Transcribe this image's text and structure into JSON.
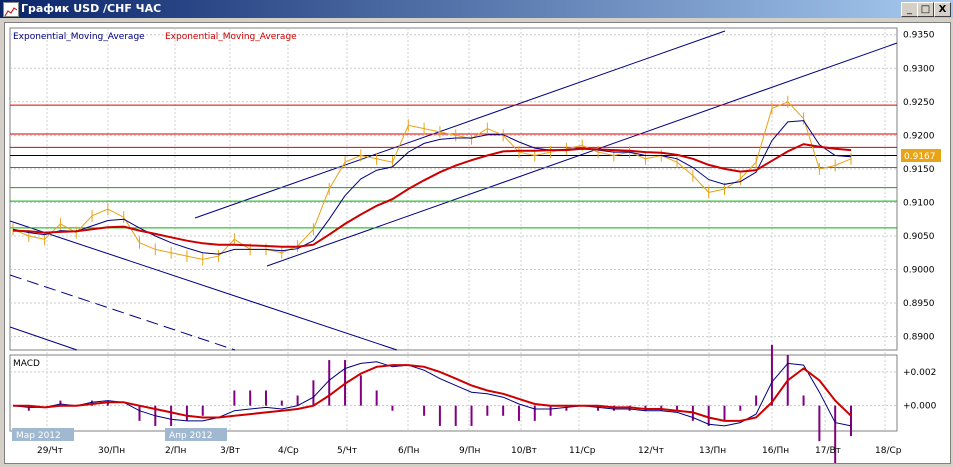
{
  "window": {
    "title": "График USD /CHF ЧАС",
    "minimize_label": "_",
    "maximize_label": "□",
    "close_label": "X"
  },
  "indicators": {
    "ema1": "Exponential_Moving_Average",
    "ema2": "Exponential_Moving_Average"
  },
  "macd_label": "MACD",
  "current_price": "0.9167",
  "month_labels": [
    "Мар 2012",
    "Апр 2012"
  ],
  "colors": {
    "price_line": "#e8a317",
    "ema_slow": "#cc0000",
    "ema_fast": "#000080",
    "channel": "#000080",
    "resistance": "#e00000",
    "support": "#00b000",
    "macd_hist": "#800080",
    "badge": "#e8a317"
  },
  "chart_data": {
    "type": "line",
    "price_axis": {
      "ylim": [
        0.888,
        0.936
      ],
      "tick_labels": [
        "0.9350",
        "0.9300",
        "0.9250",
        "0.9200",
        "0.9150",
        "0.9100",
        "0.9050",
        "0.9000",
        "0.8950",
        "0.8900"
      ]
    },
    "macd_axis": {
      "tick_labels": [
        "+0.002",
        "+0.000"
      ]
    },
    "x_labels": [
      "29/Чт",
      "30/Пн",
      "2/Пн",
      "3/Вт",
      "4/Ср",
      "5/Чт",
      "6/Пн",
      "9/Пн",
      "10/Вт",
      "11/Ср",
      "12/Чт",
      "13/Пн",
      "16/Пн",
      "17/Вт",
      "18/Ср"
    ],
    "horizontal_levels": {
      "red": [
        0.9245,
        0.9202,
        0.9182
      ],
      "dark": [
        0.917
      ],
      "green": [
        0.9152,
        0.9122,
        0.9102,
        0.9062
      ]
    },
    "series": [
      {
        "values": [
          0.906,
          0.905,
          0.9045,
          0.9068,
          0.9055,
          0.908,
          0.909,
          0.9078,
          0.904,
          0.903,
          0.9025,
          0.902,
          0.9015,
          0.902,
          0.9045,
          0.903,
          0.903,
          0.9025,
          0.9035,
          0.906,
          0.912,
          0.916,
          0.917,
          0.9165,
          0.916,
          0.9215,
          0.921,
          0.9205,
          0.92,
          0.9195,
          0.921,
          0.92,
          0.9175,
          0.917,
          0.9175,
          0.918,
          0.9185,
          0.9175,
          0.917,
          0.9175,
          0.9165,
          0.917,
          0.916,
          0.914,
          0.9115,
          0.912,
          0.9135,
          0.916,
          0.924,
          0.925,
          0.9225,
          0.915,
          0.9155,
          0.9165
        ]
      },
      {
        "values": [
          0.9058,
          0.9057,
          0.9055,
          0.9056,
          0.9057,
          0.906,
          0.9063,
          0.9064,
          0.9058,
          0.9053,
          0.9048,
          0.9043,
          0.9039,
          0.9037,
          0.9037,
          0.9036,
          0.9035,
          0.9034,
          0.9034,
          0.9037,
          0.9052,
          0.9068,
          0.9082,
          0.9095,
          0.9105,
          0.912,
          0.9133,
          0.9145,
          0.9155,
          0.9163,
          0.917,
          0.9176,
          0.9177,
          0.9177,
          0.9178,
          0.9178,
          0.918,
          0.9179,
          0.9178,
          0.9177,
          0.9175,
          0.9174,
          0.9171,
          0.9165,
          0.9156,
          0.915,
          0.9146,
          0.9148,
          0.9162,
          0.9176,
          0.9187,
          0.9183,
          0.918,
          0.9178
        ]
      },
      {
        "values": [
          0.906,
          0.9055,
          0.9052,
          0.9058,
          0.9057,
          0.9065,
          0.9073,
          0.9075,
          0.9062,
          0.905,
          0.904,
          0.9032,
          0.9025,
          0.9023,
          0.903,
          0.903,
          0.903,
          0.9028,
          0.9031,
          0.9043,
          0.9075,
          0.911,
          0.9135,
          0.9148,
          0.9153,
          0.9175,
          0.9188,
          0.9194,
          0.9196,
          0.9196,
          0.9201,
          0.9201,
          0.919,
          0.9181,
          0.9178,
          0.9179,
          0.9181,
          0.9178,
          0.9175,
          0.9175,
          0.917,
          0.917,
          0.9165,
          0.9152,
          0.9134,
          0.9127,
          0.9131,
          0.9145,
          0.9192,
          0.922,
          0.9222,
          0.9186,
          0.917,
          0.9168
        ]
      }
    ],
    "macd_series": [
      {
        "values": [
          0.0,
          -0.0001,
          -0.0001,
          0.0001,
          0.0,
          0.0002,
          0.0003,
          0.0002,
          -0.0003,
          -0.0006,
          -0.0008,
          -0.0009,
          -0.0009,
          -0.0007,
          -0.0003,
          -0.0002,
          -0.0001,
          -0.0002,
          0.0,
          0.0005,
          0.0015,
          0.0022,
          0.0025,
          0.0026,
          0.0023,
          0.0024,
          0.0021,
          0.0016,
          0.0012,
          0.0008,
          0.0007,
          0.0005,
          0.0001,
          -0.0002,
          -0.0002,
          -0.0001,
          0.0,
          -0.0001,
          -0.0002,
          -0.0002,
          -0.0003,
          -0.0003,
          -0.0004,
          -0.0007,
          -0.0011,
          -0.0012,
          -0.001,
          -0.0005,
          0.0014,
          0.0025,
          0.0024,
          0.0008,
          -0.001,
          -0.0012
        ]
      },
      {
        "values": [
          0.0,
          0.0,
          -0.0001,
          0.0,
          0.0,
          0.0001,
          0.0002,
          0.0002,
          0.0,
          -0.0002,
          -0.0004,
          -0.0006,
          -0.0007,
          -0.0007,
          -0.0006,
          -0.0005,
          -0.0004,
          -0.0003,
          -0.0002,
          0.0,
          0.0006,
          0.0013,
          0.0019,
          0.0023,
          0.0024,
          0.0024,
          0.0023,
          0.002,
          0.0016,
          0.0012,
          0.0009,
          0.0007,
          0.0004,
          0.0001,
          0.0,
          0.0,
          0.0,
          0.0,
          -0.0001,
          -0.0001,
          -0.0002,
          -0.0002,
          -0.0003,
          -0.0004,
          -0.0007,
          -0.0009,
          -0.0009,
          -0.0007,
          0.0002,
          0.0015,
          0.0022,
          0.0015,
          0.0003,
          -0.0006
        ]
      }
    ]
  }
}
